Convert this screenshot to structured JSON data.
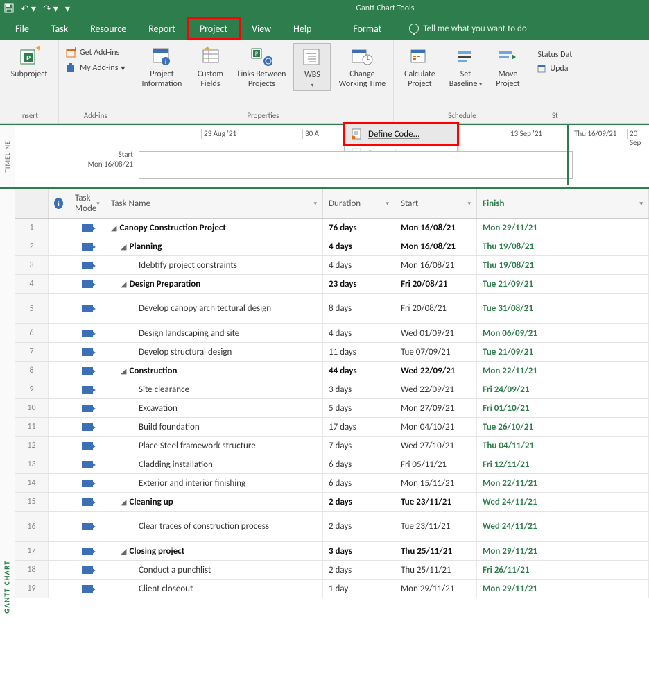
{
  "title_tools": "Gantt Chart Tools",
  "menu": {
    "file": "File",
    "task": "Task",
    "resource": "Resource",
    "report": "Report",
    "project": "Project",
    "view": "View",
    "help": "Help",
    "format": "Format",
    "tell": "Tell me what you want to do"
  },
  "ribbon": {
    "insert": {
      "subproject": "Subproject",
      "group": "Insert"
    },
    "addins": {
      "get": "Get Add-ins",
      "my": "My Add-ins",
      "group": "Add-ins"
    },
    "properties": {
      "projectinfo": "Project Information",
      "custom": "Custom Fields",
      "links": "Links Between Projects",
      "wbs": "WBS",
      "change": "Change Working Time",
      "group": "Properties"
    },
    "schedule": {
      "calculate": "Calculate Project",
      "baseline": "Set Baseline",
      "move": "Move Project",
      "group": "Schedule"
    },
    "status": {
      "date": "Status Dat",
      "update": "Upda",
      "group": "St"
    }
  },
  "wbs_menu": {
    "define": "Define Code...",
    "renumber": "Renumber..."
  },
  "timeline": {
    "side": "TIMELINE",
    "d1": "23 Aug '21",
    "d2": "30 A",
    "d3": "13 Sep '21",
    "d4": "Thu 16/09/21",
    "d5": "20 Sep",
    "start_lbl": "Start",
    "start_date": "Mon 16/08/21"
  },
  "gridside": "GANTT CHART",
  "headers": {
    "mode": "Task Mode",
    "name": "Task Name",
    "dur": "Duration",
    "start": "Start",
    "finish": "Finish"
  },
  "rows": [
    {
      "n": "1",
      "name": "Canopy Construction Project",
      "dur": "76 days",
      "start": "Mon 16/08/21",
      "finish": "Mon 29/11/21",
      "b": true,
      "lvl": 0,
      "sum": true
    },
    {
      "n": "2",
      "name": "Planning",
      "dur": "4 days",
      "start": "Mon 16/08/21",
      "finish": "Thu 19/08/21",
      "b": true,
      "lvl": 1,
      "sum": true
    },
    {
      "n": "3",
      "name": "Idebtify project constraints",
      "dur": "4 days",
      "start": "Mon 16/08/21",
      "finish": "Thu 19/08/21",
      "b": false,
      "lvl": 2
    },
    {
      "n": "4",
      "name": "Design Preparation",
      "dur": "23 days",
      "start": "Fri 20/08/21",
      "finish": "Tue 21/09/21",
      "b": true,
      "lvl": 1,
      "sum": true
    },
    {
      "n": "5",
      "name": "Develop canopy architectural design",
      "dur": "8 days",
      "start": "Fri 20/08/21",
      "finish": "Tue 31/08/21",
      "b": false,
      "lvl": 2,
      "tall": true
    },
    {
      "n": "6",
      "name": "Design landscaping and site",
      "dur": "4 days",
      "start": "Wed 01/09/21",
      "finish": "Mon 06/09/21",
      "b": false,
      "lvl": 2
    },
    {
      "n": "7",
      "name": "Develop structural design",
      "dur": "11 days",
      "start": "Tue 07/09/21",
      "finish": "Tue 21/09/21",
      "b": false,
      "lvl": 2
    },
    {
      "n": "8",
      "name": "Construction",
      "dur": "44 days",
      "start": "Wed 22/09/21",
      "finish": "Mon 22/11/21",
      "b": true,
      "lvl": 1,
      "sum": true
    },
    {
      "n": "9",
      "name": "Site clearance",
      "dur": "3 days",
      "start": "Wed 22/09/21",
      "finish": "Fri 24/09/21",
      "b": false,
      "lvl": 2
    },
    {
      "n": "10",
      "name": "Excavation",
      "dur": "5 days",
      "start": "Mon 27/09/21",
      "finish": "Fri 01/10/21",
      "b": false,
      "lvl": 2
    },
    {
      "n": "11",
      "name": "Build foundation",
      "dur": "17 days",
      "start": "Mon 04/10/21",
      "finish": "Tue 26/10/21",
      "b": false,
      "lvl": 2
    },
    {
      "n": "12",
      "name": "Place Steel framework structure",
      "dur": "7 days",
      "start": "Wed 27/10/21",
      "finish": "Thu 04/11/21",
      "b": false,
      "lvl": 2
    },
    {
      "n": "13",
      "name": "Cladding installation",
      "dur": "6 days",
      "start": "Fri 05/11/21",
      "finish": "Fri 12/11/21",
      "b": false,
      "lvl": 2
    },
    {
      "n": "14",
      "name": "Exterior and interior finishing",
      "dur": "6 days",
      "start": "Mon 15/11/21",
      "finish": "Mon 22/11/21",
      "b": false,
      "lvl": 2
    },
    {
      "n": "15",
      "name": "Cleaning up",
      "dur": "2 days",
      "start": "Tue 23/11/21",
      "finish": "Wed 24/11/21",
      "b": true,
      "lvl": 1,
      "sum": true
    },
    {
      "n": "16",
      "name": "Clear traces of construction process",
      "dur": "2 days",
      "start": "Tue 23/11/21",
      "finish": "Wed 24/11/21",
      "b": false,
      "lvl": 2,
      "tall": true
    },
    {
      "n": "17",
      "name": "Closing project",
      "dur": "3 days",
      "start": "Thu 25/11/21",
      "finish": "Mon 29/11/21",
      "b": true,
      "lvl": 1,
      "sum": true
    },
    {
      "n": "18",
      "name": "Conduct a punchlist",
      "dur": "2 days",
      "start": "Thu 25/11/21",
      "finish": "Fri 26/11/21",
      "b": false,
      "lvl": 2
    },
    {
      "n": "19",
      "name": "Client closeout",
      "dur": "1 day",
      "start": "Mon 29/11/21",
      "finish": "Mon 29/11/21",
      "b": false,
      "lvl": 2
    }
  ]
}
